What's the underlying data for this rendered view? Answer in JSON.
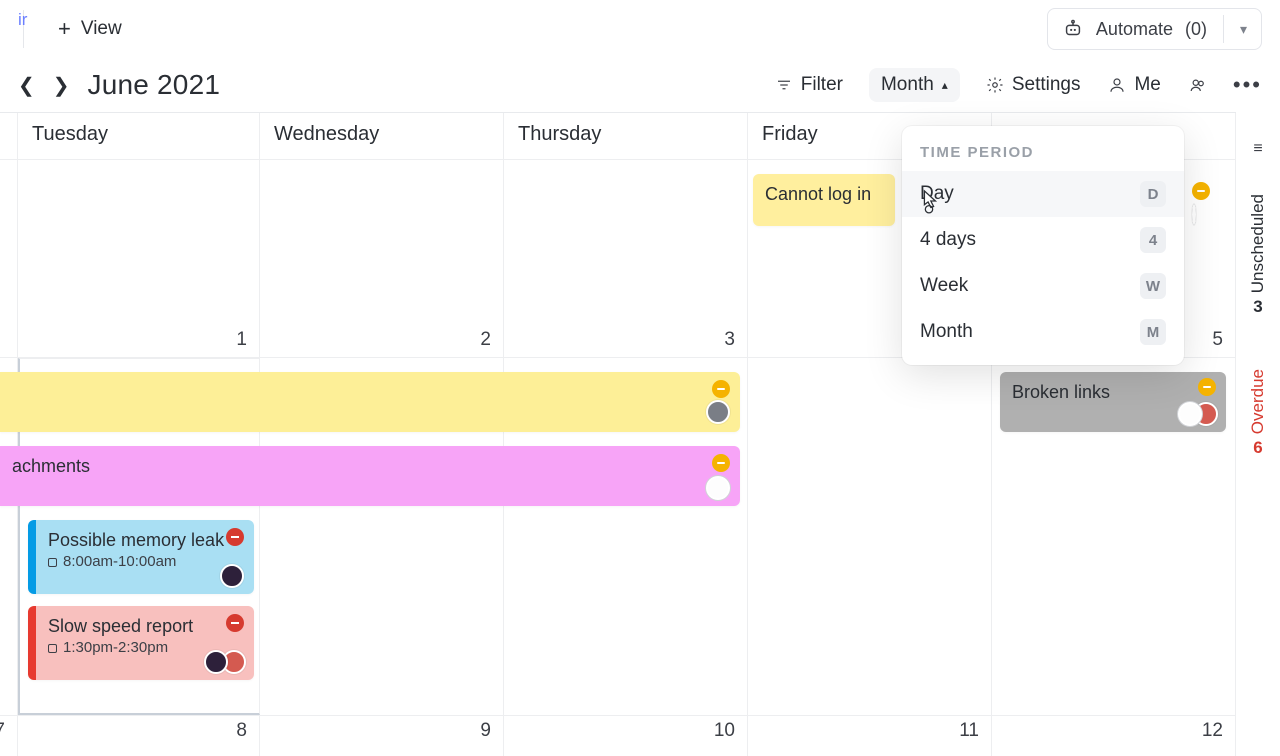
{
  "topbar": {
    "tab_edge_label": "ir",
    "add_view_label": "View",
    "automate_label": "Automate",
    "automate_count": "(0)"
  },
  "toolbar": {
    "month_title": "June 2021",
    "filter_label": "Filter",
    "period_selected": "Month",
    "settings_label": "Settings",
    "me_label": "Me"
  },
  "calendar": {
    "days": [
      "Tuesday",
      "Wednesday",
      "Thursday",
      "Friday",
      ""
    ],
    "row1_nums": [
      "",
      "1",
      "2",
      "3",
      "",
      "5"
    ],
    "row3_nums": [
      "7",
      "8",
      "9",
      "10",
      "11",
      "12"
    ],
    "events": {
      "cannot_login": "Cannot log in",
      "attachments": "achments",
      "broken_links": "Broken links",
      "memory_leak_title": "Possible memory leak",
      "memory_leak_time": "8:00am-10:00am",
      "slow_speed_title": "Slow speed report",
      "slow_speed_time": "1:30pm-2:30pm"
    }
  },
  "dropdown": {
    "title": "TIME PERIOD",
    "items": [
      {
        "label": "Day",
        "key": "D"
      },
      {
        "label": "4 days",
        "key": "4"
      },
      {
        "label": "Week",
        "key": "W"
      },
      {
        "label": "Month",
        "key": "M"
      }
    ]
  },
  "rail": {
    "unscheduled_count": "3",
    "unscheduled_label": "Unscheduled",
    "overdue_count": "6",
    "overdue_label": "Overdue"
  }
}
